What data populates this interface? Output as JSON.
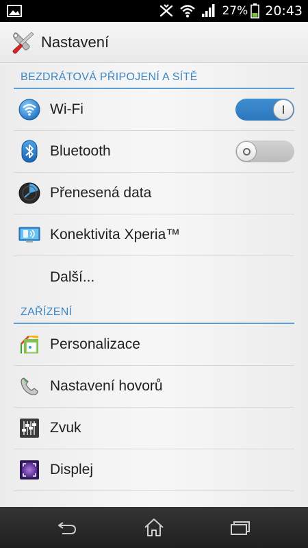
{
  "status_bar": {
    "battery_percent": "27%",
    "time": "20:43",
    "left_icons": [
      "image-notification-icon"
    ],
    "right_icons": [
      "nfc-icon",
      "wifi-signal-icon",
      "cell-signal-icon",
      "battery-icon"
    ]
  },
  "action_bar": {
    "title": "Nastavení",
    "icon": "settings-tools-icon"
  },
  "sections": [
    {
      "header": "BEZDRÁTOVÁ PŘIPOJENÍ A SÍTĚ",
      "items": [
        {
          "label": "Wi-Fi",
          "icon": "wifi-icon",
          "toggle": "on"
        },
        {
          "label": "Bluetooth",
          "icon": "bluetooth-icon",
          "toggle": "off"
        },
        {
          "label": "Přenesená data",
          "icon": "data-usage-icon"
        },
        {
          "label": "Konektivita Xperia™",
          "icon": "xperia-connectivity-icon"
        },
        {
          "label": "Další...",
          "icon": ""
        }
      ]
    },
    {
      "header": "ZAŘÍZENÍ",
      "items": [
        {
          "label": "Personalizace",
          "icon": "personalization-icon"
        },
        {
          "label": "Nastavení hovorů",
          "icon": "phone-icon"
        },
        {
          "label": "Zvuk",
          "icon": "sound-equalizer-icon"
        },
        {
          "label": "Displej",
          "icon": "display-icon"
        }
      ]
    }
  ],
  "nav_bar": {
    "buttons": [
      "back-icon",
      "home-icon",
      "recent-apps-icon"
    ]
  },
  "colors": {
    "accent": "#3d86c6",
    "toggle_on": "#3582c8",
    "status_bar": "#000000",
    "nav_bar": "#2a2a2a"
  }
}
